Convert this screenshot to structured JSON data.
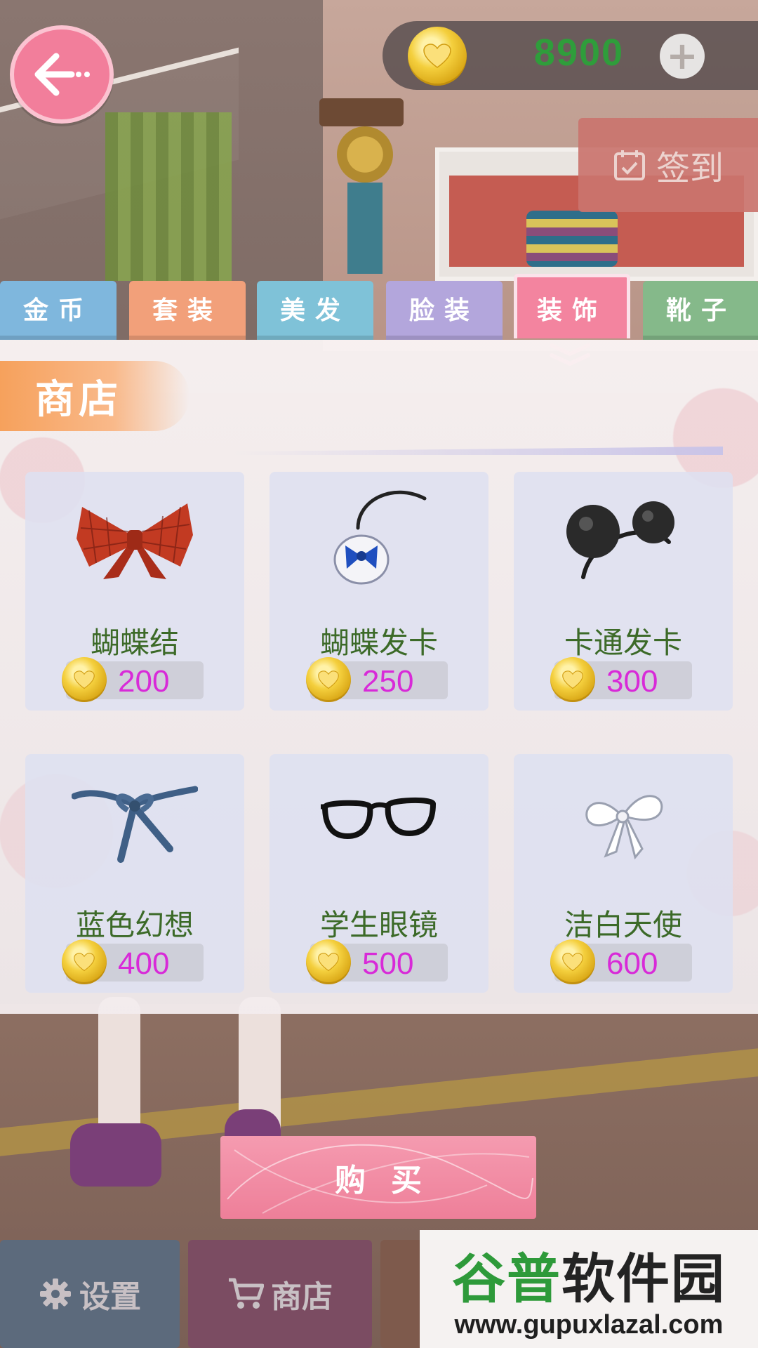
{
  "header": {
    "coins": "8900",
    "checkin_label": "签到"
  },
  "tabs": [
    {
      "label": "金币",
      "color": "#7fb7dd"
    },
    {
      "label": "套装",
      "color": "#f2a07a"
    },
    {
      "label": "美发",
      "color": "#7fc2d8"
    },
    {
      "label": "脸装",
      "color": "#b3a6dc"
    },
    {
      "label": "装饰",
      "color": "#f3849f",
      "active": true
    },
    {
      "label": "靴子",
      "color": "#85b98a"
    }
  ],
  "shop": {
    "title": "商店",
    "items": [
      {
        "name": "蝴蝶结",
        "price": "200",
        "icon": "red-bow-icon"
      },
      {
        "name": "蝴蝶发卡",
        "price": "250",
        "icon": "bow-hairclip-icon"
      },
      {
        "name": "卡通发卡",
        "price": "300",
        "icon": "mouse-ears-icon"
      },
      {
        "name": "蓝色幻想",
        "price": "400",
        "icon": "blue-ribbon-icon"
      },
      {
        "name": "学生眼镜",
        "price": "500",
        "icon": "glasses-icon"
      },
      {
        "name": "洁白天使",
        "price": "600",
        "icon": "white-bow-icon"
      }
    ]
  },
  "buy_label": "购买",
  "bottom_nav": {
    "settings_label": "设置",
    "shop_label": "商店"
  },
  "watermark": {
    "brand_part1": "谷普",
    "brand_part2": "软件园",
    "url": "www.gupuxlazal.com"
  },
  "colors": {
    "accent_pink": "#f27e9b",
    "coin_green": "#2f9d3b",
    "price_magenta": "#d82ad8",
    "item_name_green": "#3c6a28"
  }
}
